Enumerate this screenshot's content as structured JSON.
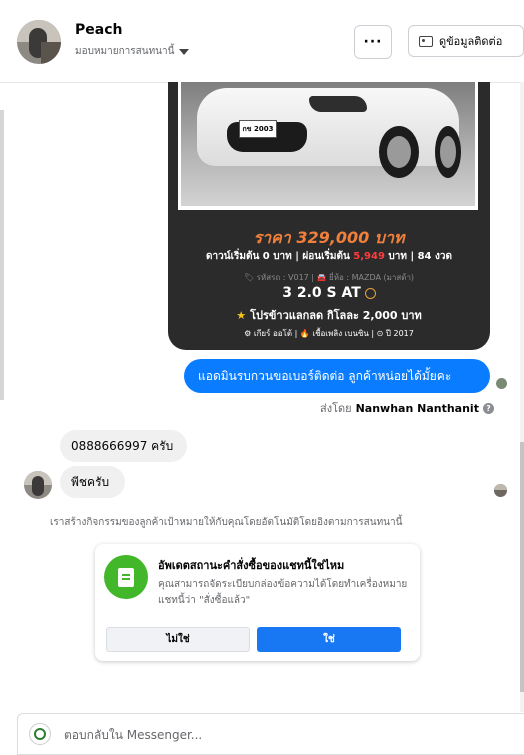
{
  "header": {
    "name": "Peach",
    "assignment": "มอบหมายการสนทนานี้",
    "more_label": "···",
    "contact_button_label": "ดูข้อมูลติดต่อ"
  },
  "listing": {
    "plate_text": "กข 2003",
    "price": "ราคา 329,000 บาท",
    "down_payment_prefix": "ดาวน์เริ่มต้น 0 บาท | ผ่อนเริ่มต้น ",
    "monthly_amount": "5,949",
    "down_payment_suffix": " บาท | 84 งวด",
    "meta": "🏷 รหัสรถ : V017 | 🚘 ยี่ห้อ : MAZDA (มาสด้า)",
    "model": "3 2.0 S AT",
    "promo": "โปรข้าวแลกลด กิโลละ 2,000 บาท",
    "footer": "⚙ เกียร์ ออโต้  |  🔥 เชื้อเพลิง เบนซิน  |  ⊙ ปี 2017"
  },
  "messages": {
    "outgoing_text": "แอดมินรบกวนขอเบอร์ติดต่อ ลูกค้าหน่อยได้มั้ยคะ",
    "sent_by_prefix": "ส่งโดย",
    "sent_by_name": "Nanwhan Nanthanit",
    "incoming_1": "0888666997 ครับ",
    "incoming_2": "พีชครับ"
  },
  "info_line": "เราสร้างกิจกรรมของลูกค้าเป้าหมายให้กับคุณโดยอัตโนมัติโดยอิงตามการสนทนานี้",
  "prompt": {
    "title": "อัพเดตสถานะคำสั่งซื้อของแชทนี้ใช่ไหม",
    "body": "คุณสามารถจัดระเบียบกล่องข้อความได้โดยทำเครื่องหมายแชทนี้ว่า \"สั่งซื้อแล้ว\"",
    "no_label": "ไม่ใช่",
    "yes_label": "ใช่"
  },
  "reply": {
    "placeholder": "ตอบกลับใน Messenger..."
  },
  "colors": {
    "accent": "#0a7cff",
    "primary_button": "#1877f2",
    "success": "#42b72a",
    "price": "#f0803c"
  }
}
